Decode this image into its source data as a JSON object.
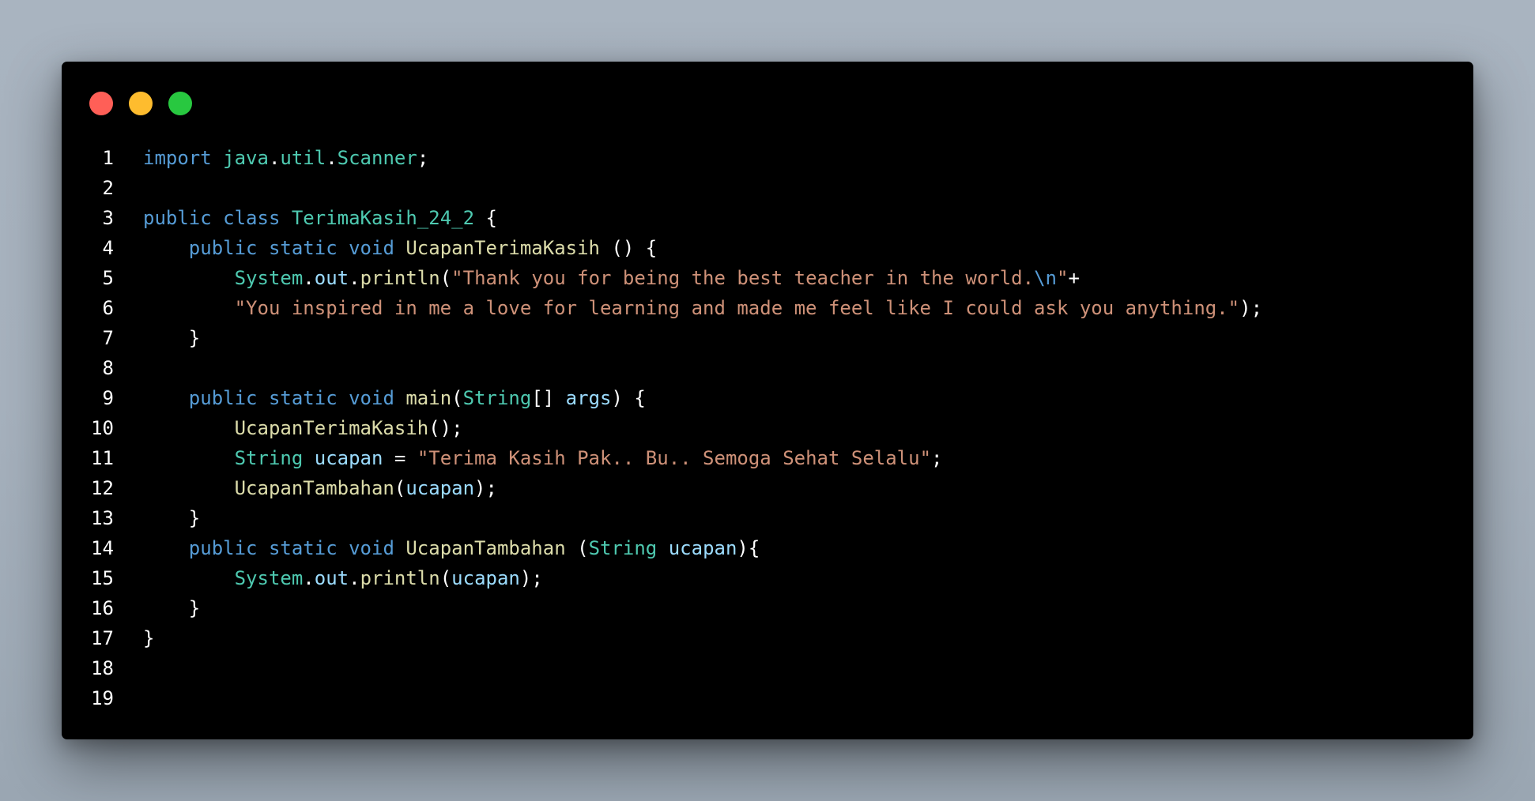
{
  "window_controls": [
    {
      "name": "close",
      "color": "#ff5f57"
    },
    {
      "name": "minimize",
      "color": "#febc2e"
    },
    {
      "name": "maximize",
      "color": "#28c840"
    }
  ],
  "colors": {
    "keyword": "#569cd6",
    "type": "#4ec9b0",
    "function": "#dcdcaa",
    "variable": "#9cdcfe",
    "string": "#ce9178",
    "plain": "#ffffff"
  },
  "code": {
    "lines": [
      {
        "number": "1",
        "tokens": [
          {
            "t": "keyword",
            "v": "import"
          },
          {
            "t": "plain",
            "v": " "
          },
          {
            "t": "type",
            "v": "java"
          },
          {
            "t": "plain",
            "v": "."
          },
          {
            "t": "type",
            "v": "util"
          },
          {
            "t": "plain",
            "v": "."
          },
          {
            "t": "type",
            "v": "Scanner"
          },
          {
            "t": "plain",
            "v": ";"
          }
        ]
      },
      {
        "number": "2",
        "tokens": []
      },
      {
        "number": "3",
        "tokens": [
          {
            "t": "keyword",
            "v": "public"
          },
          {
            "t": "plain",
            "v": " "
          },
          {
            "t": "keyword",
            "v": "class"
          },
          {
            "t": "plain",
            "v": " "
          },
          {
            "t": "type",
            "v": "TerimaKasih_24_2"
          },
          {
            "t": "plain",
            "v": " {"
          }
        ]
      },
      {
        "number": "4",
        "tokens": [
          {
            "t": "plain",
            "v": "    "
          },
          {
            "t": "keyword",
            "v": "public"
          },
          {
            "t": "plain",
            "v": " "
          },
          {
            "t": "keyword",
            "v": "static"
          },
          {
            "t": "plain",
            "v": " "
          },
          {
            "t": "keyword",
            "v": "void"
          },
          {
            "t": "plain",
            "v": " "
          },
          {
            "t": "func",
            "v": "UcapanTerimaKasih"
          },
          {
            "t": "plain",
            "v": " () {"
          }
        ]
      },
      {
        "number": "5",
        "tokens": [
          {
            "t": "plain",
            "v": "        "
          },
          {
            "t": "type",
            "v": "System"
          },
          {
            "t": "plain",
            "v": "."
          },
          {
            "t": "var",
            "v": "out"
          },
          {
            "t": "plain",
            "v": "."
          },
          {
            "t": "func",
            "v": "println"
          },
          {
            "t": "plain",
            "v": "("
          },
          {
            "t": "string",
            "v": "\"Thank you for being the best teacher in the world."
          },
          {
            "t": "escape",
            "v": "\\n"
          },
          {
            "t": "string",
            "v": "\""
          },
          {
            "t": "plain",
            "v": "+"
          }
        ]
      },
      {
        "number": "6",
        "tokens": [
          {
            "t": "plain",
            "v": "        "
          },
          {
            "t": "string",
            "v": "\"You inspired in me a love for learning and made me feel like I could ask you anything.\""
          },
          {
            "t": "plain",
            "v": ");"
          }
        ]
      },
      {
        "number": "7",
        "tokens": [
          {
            "t": "plain",
            "v": "    }"
          }
        ]
      },
      {
        "number": "8",
        "tokens": []
      },
      {
        "number": "9",
        "tokens": [
          {
            "t": "plain",
            "v": "    "
          },
          {
            "t": "keyword",
            "v": "public"
          },
          {
            "t": "plain",
            "v": " "
          },
          {
            "t": "keyword",
            "v": "static"
          },
          {
            "t": "plain",
            "v": " "
          },
          {
            "t": "keyword",
            "v": "void"
          },
          {
            "t": "plain",
            "v": " "
          },
          {
            "t": "func",
            "v": "main"
          },
          {
            "t": "plain",
            "v": "("
          },
          {
            "t": "type",
            "v": "String"
          },
          {
            "t": "plain",
            "v": "[] "
          },
          {
            "t": "var",
            "v": "args"
          },
          {
            "t": "plain",
            "v": ") {"
          }
        ]
      },
      {
        "number": "10",
        "tokens": [
          {
            "t": "plain",
            "v": "        "
          },
          {
            "t": "func",
            "v": "UcapanTerimaKasih"
          },
          {
            "t": "plain",
            "v": "();"
          }
        ]
      },
      {
        "number": "11",
        "tokens": [
          {
            "t": "plain",
            "v": "        "
          },
          {
            "t": "type",
            "v": "String"
          },
          {
            "t": "plain",
            "v": " "
          },
          {
            "t": "var",
            "v": "ucapan"
          },
          {
            "t": "plain",
            "v": " = "
          },
          {
            "t": "string",
            "v": "\"Terima Kasih Pak.. Bu.. Semoga Sehat Selalu\""
          },
          {
            "t": "plain",
            "v": ";"
          }
        ]
      },
      {
        "number": "12",
        "tokens": [
          {
            "t": "plain",
            "v": "        "
          },
          {
            "t": "func",
            "v": "UcapanTambahan"
          },
          {
            "t": "plain",
            "v": "("
          },
          {
            "t": "var",
            "v": "ucapan"
          },
          {
            "t": "plain",
            "v": ");"
          }
        ]
      },
      {
        "number": "13",
        "tokens": [
          {
            "t": "plain",
            "v": "    }"
          }
        ]
      },
      {
        "number": "14",
        "tokens": [
          {
            "t": "plain",
            "v": "    "
          },
          {
            "t": "keyword",
            "v": "public"
          },
          {
            "t": "plain",
            "v": " "
          },
          {
            "t": "keyword",
            "v": "static"
          },
          {
            "t": "plain",
            "v": " "
          },
          {
            "t": "keyword",
            "v": "void"
          },
          {
            "t": "plain",
            "v": " "
          },
          {
            "t": "func",
            "v": "UcapanTambahan"
          },
          {
            "t": "plain",
            "v": " ("
          },
          {
            "t": "type",
            "v": "String"
          },
          {
            "t": "plain",
            "v": " "
          },
          {
            "t": "var",
            "v": "ucapan"
          },
          {
            "t": "plain",
            "v": "){"
          }
        ]
      },
      {
        "number": "15",
        "tokens": [
          {
            "t": "plain",
            "v": "        "
          },
          {
            "t": "type",
            "v": "System"
          },
          {
            "t": "plain",
            "v": "."
          },
          {
            "t": "var",
            "v": "out"
          },
          {
            "t": "plain",
            "v": "."
          },
          {
            "t": "func",
            "v": "println"
          },
          {
            "t": "plain",
            "v": "("
          },
          {
            "t": "var",
            "v": "ucapan"
          },
          {
            "t": "plain",
            "v": ");"
          }
        ]
      },
      {
        "number": "16",
        "tokens": [
          {
            "t": "plain",
            "v": "    }"
          }
        ]
      },
      {
        "number": "17",
        "tokens": [
          {
            "t": "plain",
            "v": "}"
          }
        ]
      },
      {
        "number": "18",
        "tokens": []
      },
      {
        "number": "19",
        "tokens": []
      }
    ]
  }
}
